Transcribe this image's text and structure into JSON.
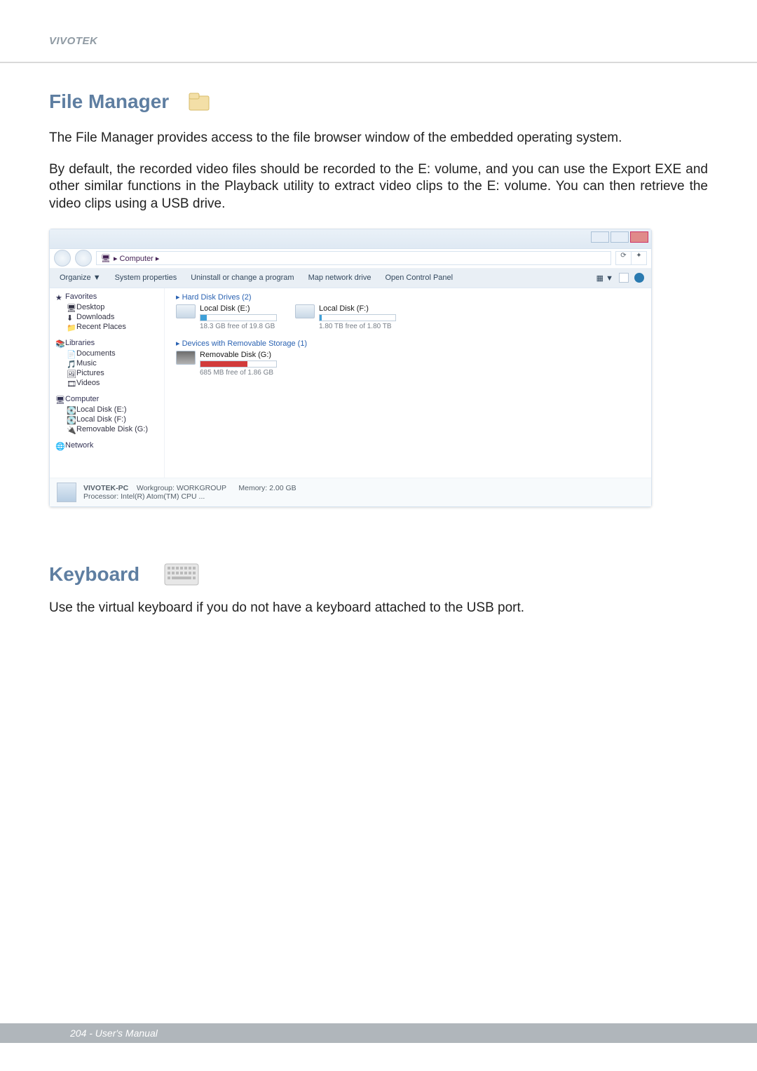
{
  "brand": "VIVOTEK",
  "section1": {
    "title": "File Manager",
    "p1": "The File Manager provides access to the file browser window of the embedded operating system.",
    "p2": "By default, the recorded video files should be recorded to the E: volume, and you can use the Export EXE and other similar functions in the Playback utility to extract video clips to the E: volume. You can then retrieve the video clips using a USB drive."
  },
  "explorer": {
    "breadcrumb": "▸ Computer ▸",
    "search_refresh": "⟳",
    "search_dropdown": "✦",
    "toolbar": {
      "organize": "Organize ▼",
      "sysprops": "System properties",
      "uninstall": "Uninstall or change a program",
      "mapdrive": "Map network drive",
      "opencp": "Open Control Panel",
      "viewmode": "▦ ▼"
    },
    "nav": {
      "favorites": {
        "head": "Favorites",
        "items": [
          "Desktop",
          "Downloads",
          "Recent Places"
        ]
      },
      "libraries": {
        "head": "Libraries",
        "items": [
          "Documents",
          "Music",
          "Pictures",
          "Videos"
        ]
      },
      "computer": {
        "head": "Computer",
        "items": [
          "Local Disk (E:)",
          "Local Disk (F:)",
          "Removable Disk (G:)"
        ]
      },
      "network": {
        "head": "Network"
      }
    },
    "main": {
      "cat1": "▸ Hard Disk Drives (2)",
      "drive_e": {
        "name": "Local Disk (E:)",
        "sub": "18.3 GB free of 19.8 GB",
        "fill": 8
      },
      "drive_f": {
        "name": "Local Disk (F:)",
        "sub": "1.80 TB free of 1.80 TB",
        "fill": 3
      },
      "cat2": "▸ Devices with Removable Storage (1)",
      "drive_g": {
        "name": "Removable Disk (G:)",
        "sub": "685 MB free of 1.86 GB",
        "fill": 62
      }
    },
    "status": {
      "line1_a": "VIVOTEK-PC",
      "line1_b": "Workgroup: WORKGROUP",
      "line1_c": "Memory: 2.00 GB",
      "line2": "Processor: Intel(R) Atom(TM) CPU ..."
    }
  },
  "section2": {
    "title": "Keyboard",
    "p1": "Use the virtual keyboard if you do not have a keyboard attached to the USB port."
  },
  "footer": "204 - User's Manual"
}
